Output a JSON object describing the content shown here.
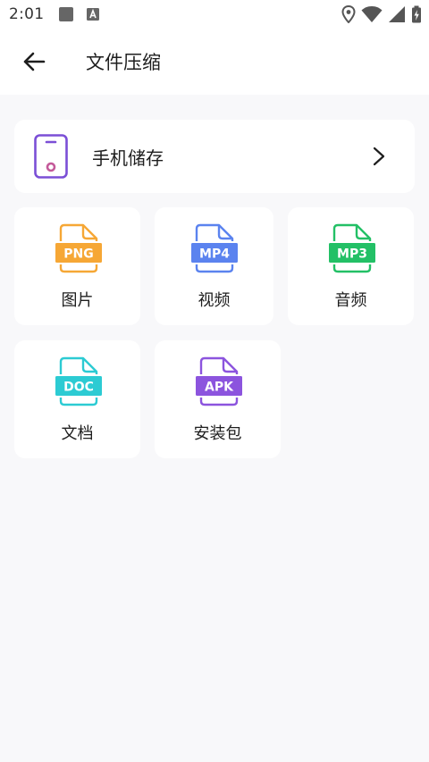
{
  "status": {
    "time": "2:01"
  },
  "header": {
    "title": "文件压缩"
  },
  "storage": {
    "label": "手机储存",
    "accent": "#7b4fd6"
  },
  "categories": [
    {
      "label": "图片",
      "badge": "PNG",
      "color": "#f6a735"
    },
    {
      "label": "视频",
      "badge": "MP4",
      "color": "#5b83ef"
    },
    {
      "label": "音频",
      "badge": "MP3",
      "color": "#23c066"
    },
    {
      "label": "文档",
      "badge": "DOC",
      "color": "#2ccbd3"
    },
    {
      "label": "安装包",
      "badge": "APK",
      "color": "#8c54de"
    }
  ]
}
